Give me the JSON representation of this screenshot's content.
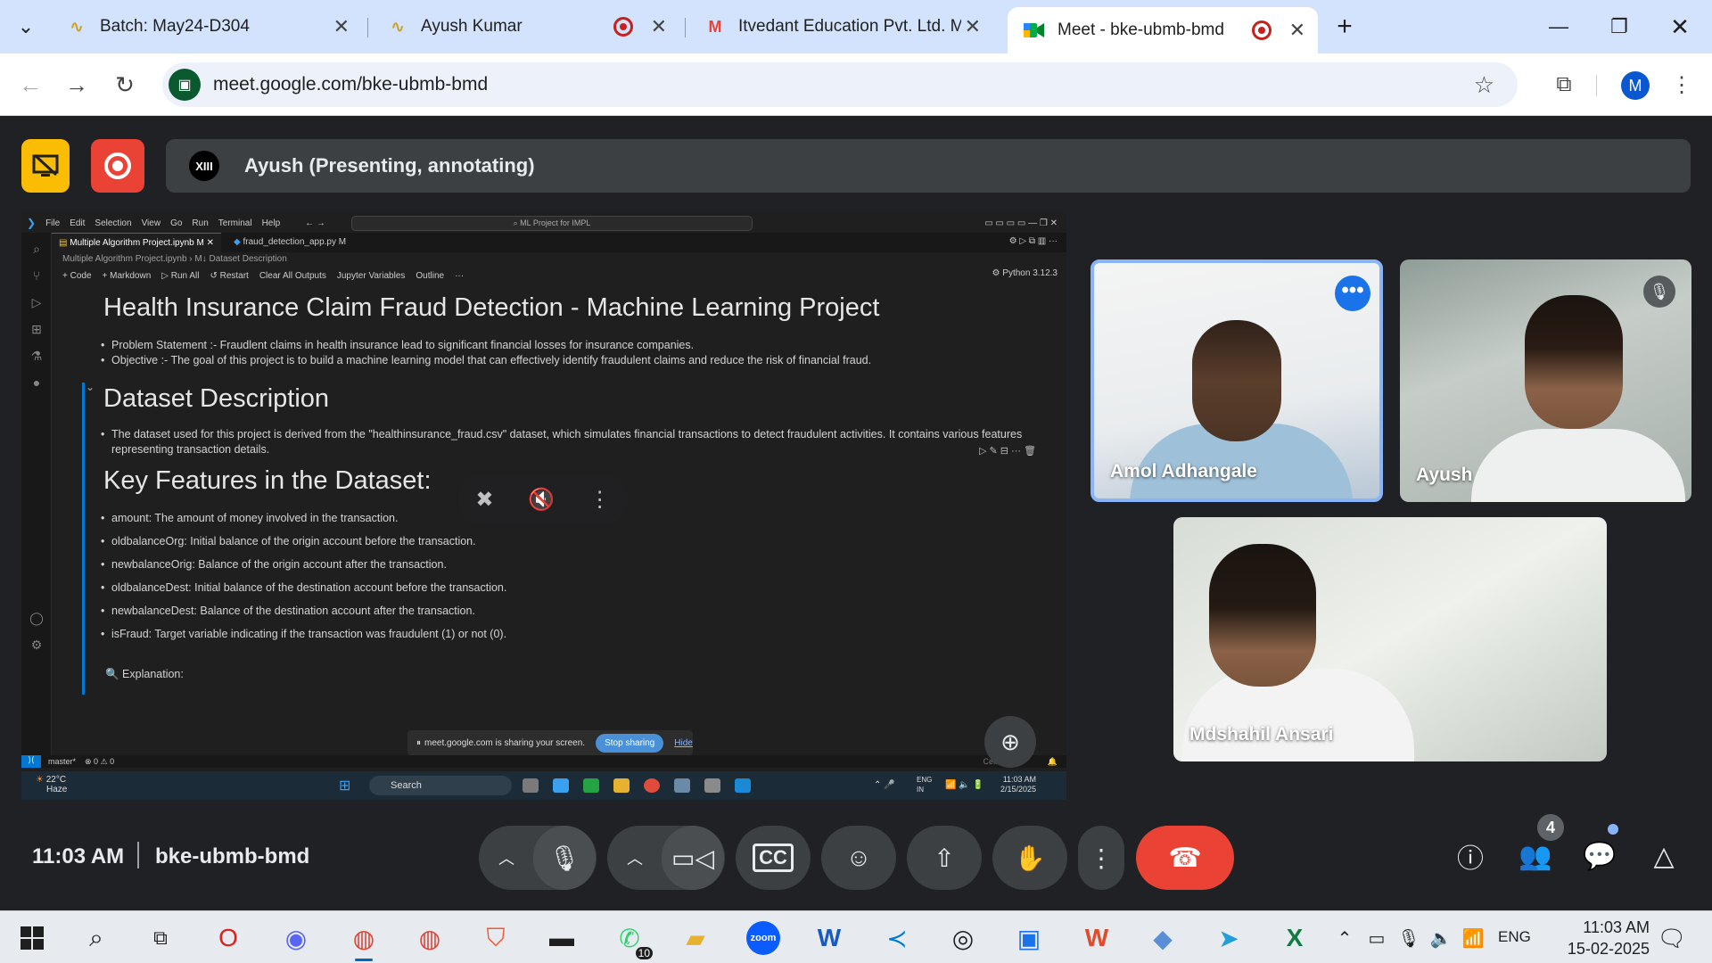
{
  "browser": {
    "tabs": [
      {
        "title": "Batch: May24-D304",
        "favicon": "waveform-icon"
      },
      {
        "title": "Ayush Kumar",
        "favicon": "waveform-icon",
        "recording": true
      },
      {
        "title": "Itvedant Education Pvt. Ltd. Ma",
        "favicon": "gmail-icon"
      },
      {
        "title": "Meet - bke-ubmb-bmd",
        "favicon": "meet-icon",
        "recording": true,
        "active": true
      }
    ],
    "url": "meet.google.com/bke-ubmb-bmd",
    "profile_initial": "M"
  },
  "meet": {
    "presenter_label": "Ayush (Presenting, annotating)",
    "presenter_logo": "XIII",
    "time": "11:03 AM",
    "meeting_code": "bke-ubmb-bmd",
    "people_count": "4",
    "participants": [
      {
        "name": "Amol Adhangale",
        "speaking": true
      },
      {
        "name": "Ayush",
        "muted": true
      },
      {
        "name": "Mdshahil Ansari"
      }
    ]
  },
  "shared_screen": {
    "menu": [
      "File",
      "Edit",
      "Selection",
      "View",
      "Go",
      "Run",
      "Terminal",
      "Help"
    ],
    "search": "ML Project for IMPL",
    "tabs": [
      "Multiple Algorithm Project.ipynb M",
      "fraud_detection_app.py M"
    ],
    "breadcrumb": "Multiple Algorithm Project.ipynb › M↓ Dataset Description",
    "toolbar": [
      "+ Code",
      "+ Markdown",
      "▷ Run All",
      "↺ Restart",
      "Clear All Outputs",
      "Jupyter Variables",
      "Outline",
      "···"
    ],
    "kernel": "Python 3.12.3",
    "title": "Health Insurance Claim Fraud Detection - Machine Learning Project",
    "intro_bullets": [
      "Problem Statement :- Fraudlent claims in health insurance lead to significant financial losses for insurance companies.",
      "Objective :- The goal of this project is to build a machine learning model that can effectively identify fraudulent claims and reduce the risk of financial fraud."
    ],
    "dataset_heading": "Dataset Description",
    "dataset_text": "The dataset used for this project is derived from the \"healthinsurance_fraud.csv\" dataset, which simulates financial transactions to detect fraudulent activities. It contains various features representing transaction details.",
    "features_heading": "Key Features in the Dataset:",
    "features": [
      "amount: The amount of money involved in the transaction.",
      "oldbalanceOrg: Initial balance of the origin account before the transaction.",
      "newbalanceOrig: Balance of the origin account after the transaction.",
      "oldbalanceDest: Initial balance of the destination account before the transaction.",
      "newbalanceDest: Balance of the destination account after the transaction.",
      "isFraud: Target variable indicating if the transaction was fraudulent (1) or not (0)."
    ],
    "explanation": "Explanation:",
    "share_notice": "meet.google.com is sharing your screen.",
    "stop_sharing": "Stop sharing",
    "hide": "Hide",
    "status_branch": "master*",
    "status_problems": "⊗ 0 ⚠ 0",
    "cell_counter": "Cell 3 of 40",
    "weather_temp": "22°C",
    "weather_desc": "Haze",
    "inner_search": "Search",
    "inner_lang": "ENG\nIN",
    "inner_time": "11:03 AM",
    "inner_date": "2/15/2025"
  },
  "taskbar": {
    "lang": "ENG",
    "time": "11:03 AM",
    "date": "15-02-2025",
    "whatsapp_badge": "10"
  }
}
